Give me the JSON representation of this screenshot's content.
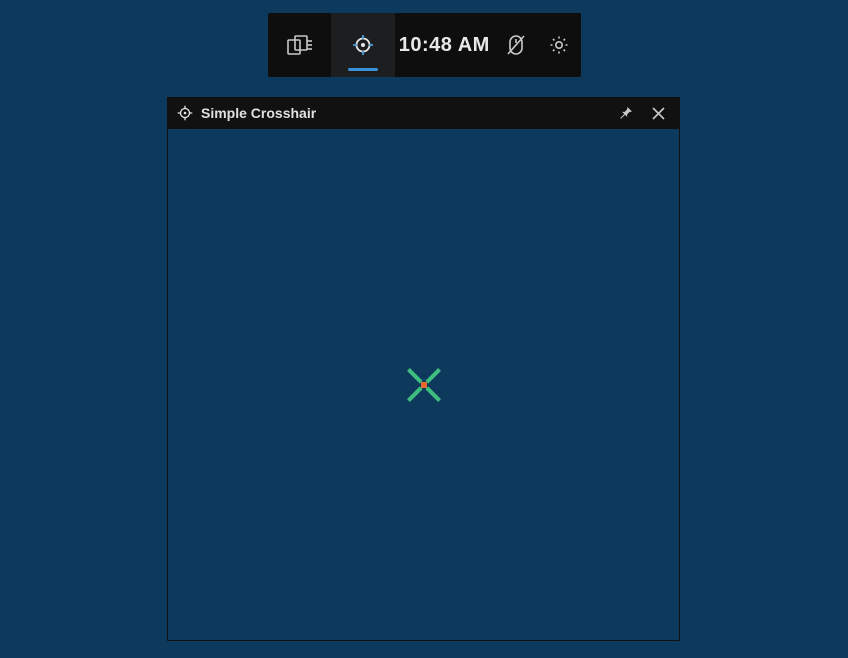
{
  "toolbar": {
    "clock": "10:48 AM"
  },
  "window": {
    "title": "Simple Crosshair"
  },
  "crosshair": {
    "dot_color": "#e86a2f",
    "line_color": "#3fbf7f"
  }
}
